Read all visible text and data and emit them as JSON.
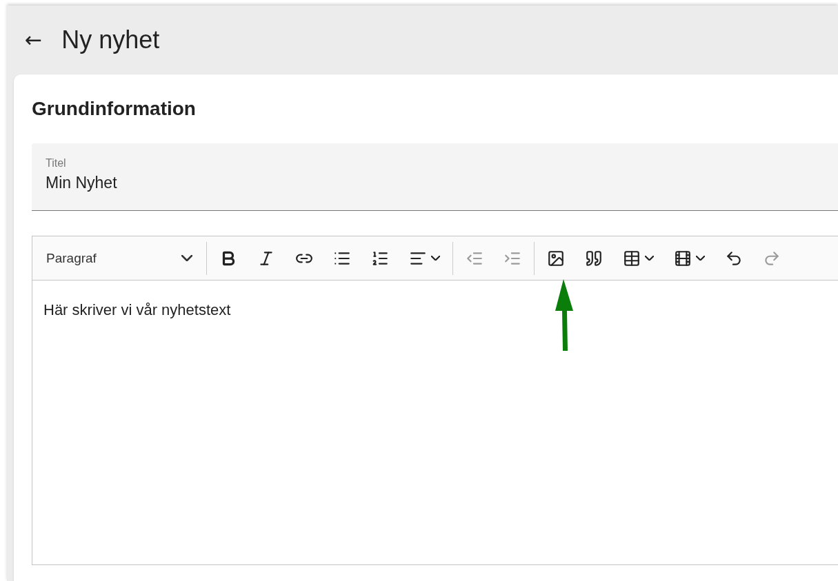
{
  "header": {
    "back": "←",
    "title": "Ny nyhet"
  },
  "card": {
    "heading": "Grundinformation",
    "title_field": {
      "label": "Titel",
      "value": "Min Nyhet"
    },
    "editor": {
      "format_select": "Paragraf",
      "groups": [
        [
          {
            "disabled": false,
            "dropdown": false
          },
          {
            "disabled": false,
            "dropdown": false
          },
          {
            "disabled": false,
            "dropdown": false
          },
          {
            "disabled": false,
            "dropdown": false
          },
          {
            "disabled": false,
            "dropdown": false
          },
          {
            "disabled": false,
            "dropdown": true
          }
        ],
        [
          {
            "disabled": true,
            "dropdown": false
          },
          {
            "disabled": true,
            "dropdown": false
          }
        ],
        [
          {
            "disabled": false,
            "dropdown": false
          },
          {
            "disabled": false,
            "dropdown": false
          },
          {
            "disabled": false,
            "dropdown": true
          },
          {
            "disabled": false,
            "dropdown": true
          },
          {
            "disabled": false,
            "dropdown": false
          },
          {
            "disabled": true,
            "dropdown": false
          }
        ]
      ],
      "content": "Här skriver vi vår nyhetstext"
    }
  }
}
